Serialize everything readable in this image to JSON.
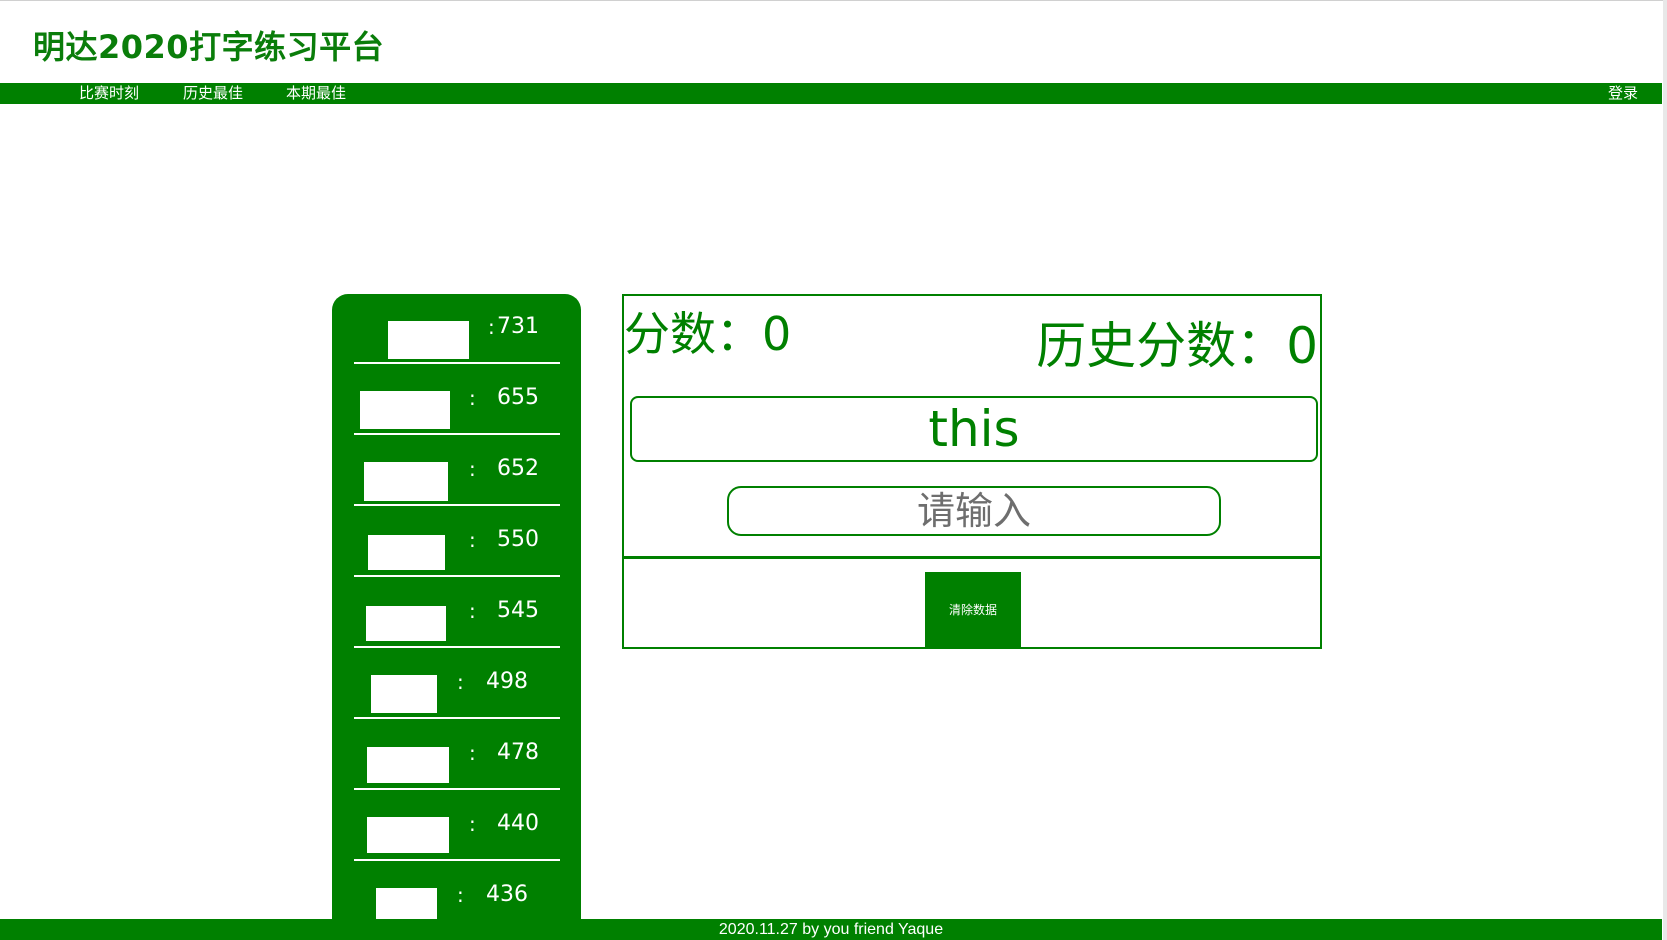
{
  "site": {
    "title": "明达2020打字练习平台"
  },
  "nav": {
    "items": [
      {
        "label": "比赛时刻"
      },
      {
        "label": "历史最佳"
      },
      {
        "label": "本期最佳"
      }
    ],
    "login_label": "登录"
  },
  "leaderboard": {
    "separator": ":",
    "entries": [
      {
        "name": "",
        "score": "731"
      },
      {
        "name": "",
        "score": "655"
      },
      {
        "name": "",
        "score": "652"
      },
      {
        "name": "",
        "score": "550"
      },
      {
        "name": "",
        "score": "545"
      },
      {
        "name": "",
        "score": "498"
      },
      {
        "name": "",
        "score": "478"
      },
      {
        "name": "",
        "score": "440"
      },
      {
        "name": "",
        "score": "436"
      }
    ]
  },
  "game": {
    "score_label": "分数：",
    "score_value": "0",
    "history_label": "历史分数：",
    "history_value": "0",
    "current_word": "this",
    "input_value": "",
    "input_placeholder": "请输入",
    "clear_button_label": "清除数据"
  },
  "footer": {
    "text": "2020.11.27 by you friend Yaque"
  },
  "colors": {
    "brand_green": "#008000",
    "background": "#ffffff",
    "placeholder_gray": "#6e6e6e"
  }
}
